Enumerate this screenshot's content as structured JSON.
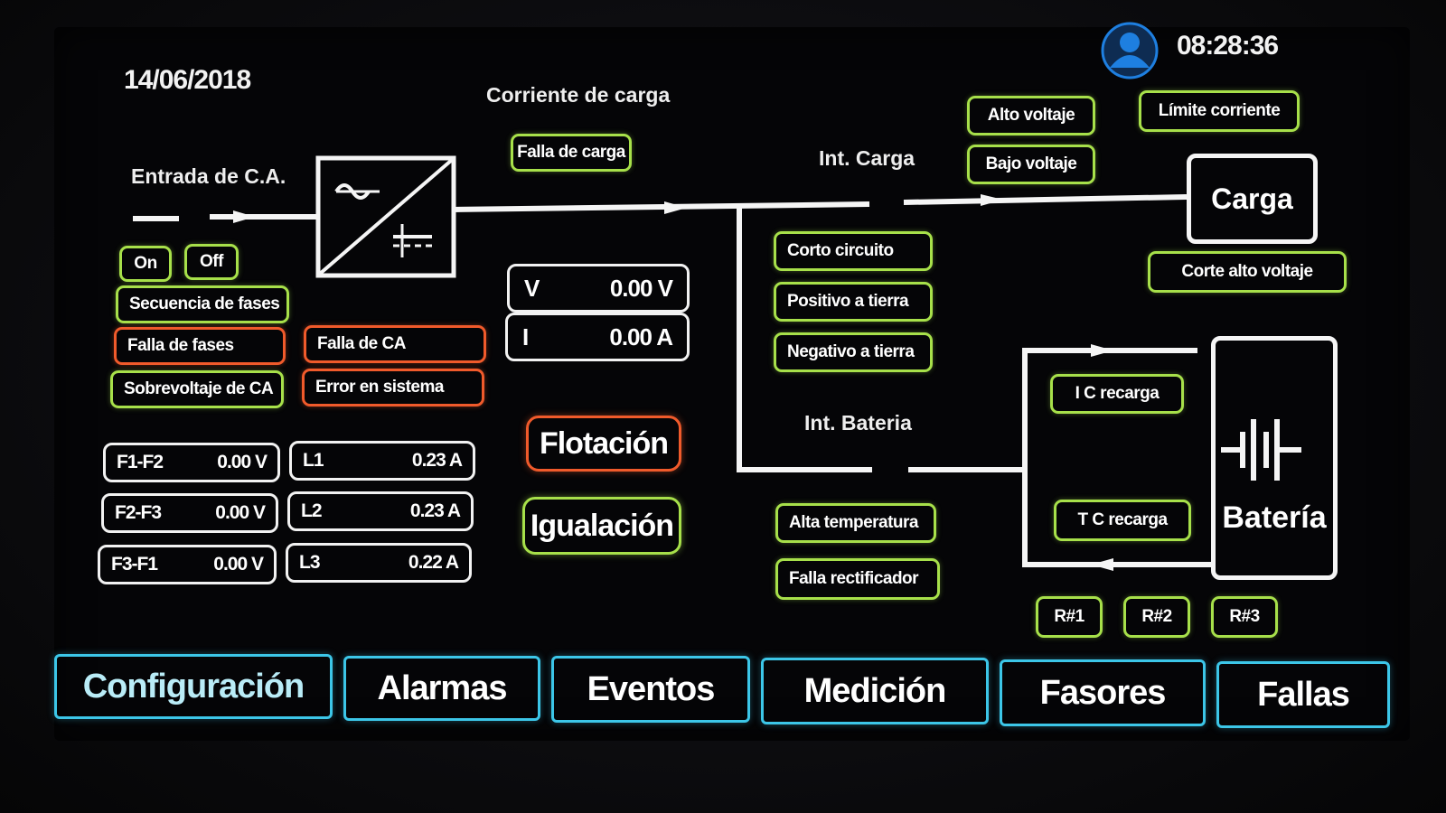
{
  "header": {
    "date": "14/06/2018",
    "time": "08:28:36",
    "user_icon": "user-icon"
  },
  "labels": {
    "corriente_carga": "Corriente de carga",
    "entrada_ca": "Entrada de C.A.",
    "int_carga": "Int. Carga",
    "int_bateria": "Int. Bateria"
  },
  "controls": {
    "on": "On",
    "off": "Off"
  },
  "indicators": {
    "secuencia_fases": "Secuencia de fases",
    "falla_fases": "Falla de fases",
    "sobrevoltaje_ca": "Sobrevoltaje de CA",
    "falla_ca": "Falla de CA",
    "error_sistema": "Error en sistema",
    "falla_carga": "Falla de carga",
    "alto_voltaje": "Alto voltaje",
    "bajo_voltaje": "Bajo voltaje",
    "limite_corriente": "Límite corriente",
    "corte_alto_voltaje": "Corte alto voltaje",
    "corto_circuito": "Corto circuito",
    "positivo_tierra": "Positivo a tierra",
    "negativo_tierra": "Negativo a tierra",
    "alta_temperatura": "Alta temperatura",
    "falla_rectificador": "Falla rectificador",
    "ic_recarga": "I C recarga",
    "tc_recarga": "T C recarga",
    "r1": "R#1",
    "r2": "R#2",
    "r3": "R#3"
  },
  "phase_voltages": [
    {
      "label": "F1-F2",
      "value": "0.00 V"
    },
    {
      "label": "F2-F3",
      "value": "0.00 V"
    },
    {
      "label": "F3-F1",
      "value": "0.00 V"
    }
  ],
  "line_currents": [
    {
      "label": "L1",
      "value": "0.23 A"
    },
    {
      "label": "L2",
      "value": "0.23 A"
    },
    {
      "label": "L3",
      "value": "0.22 A"
    }
  ],
  "output": {
    "v_label": "V",
    "v_value": "0.00 V",
    "i_label": "I",
    "i_value": "0.00 A"
  },
  "modes": {
    "flotacion": "Flotación",
    "igualacion": "Igualación"
  },
  "blocks": {
    "carga": "Carga",
    "bateria": "Batería"
  },
  "nav": [
    "Configuración",
    "Alarmas",
    "Eventos",
    "Medición",
    "Fasores",
    "Fallas"
  ],
  "colors": {
    "ok": "#a7e04a",
    "alarm": "#f05a2b",
    "nav": "#3cc6e8",
    "line": "#f5f5f5",
    "user": "#1e7fe0"
  }
}
